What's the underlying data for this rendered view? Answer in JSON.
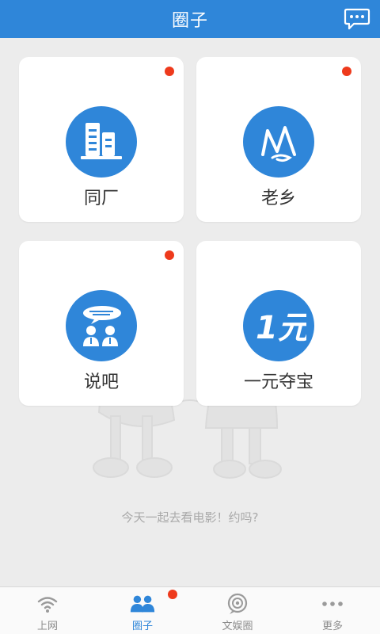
{
  "header": {
    "title": "圈子"
  },
  "cards": [
    {
      "label": "同厂",
      "icon": "factory-buildings-icon",
      "has_dot": true
    },
    {
      "label": "老乡",
      "icon": "hometown-mountain-icon",
      "has_dot": true
    },
    {
      "label": "说吧",
      "icon": "talk-people-icon",
      "has_dot": true
    },
    {
      "label": "一元夺宝",
      "icon": "one-yuan-icon",
      "icon_text": "1元",
      "has_dot": false
    }
  ],
  "caption": "今天一起去看电影！约吗?",
  "bottom_nav": {
    "items": [
      {
        "label": "上网",
        "icon": "wifi-icon",
        "active": false
      },
      {
        "label": "圈子",
        "icon": "people-icon",
        "active": true,
        "badge": true
      },
      {
        "label": "文娱圈",
        "icon": "camera-target-icon",
        "active": false
      },
      {
        "label": "更多",
        "icon": "more-dots-icon",
        "active": false
      }
    ]
  },
  "colors": {
    "primary": "#2f86d9",
    "badge": "#ee3a1c",
    "background": "#ececec"
  }
}
